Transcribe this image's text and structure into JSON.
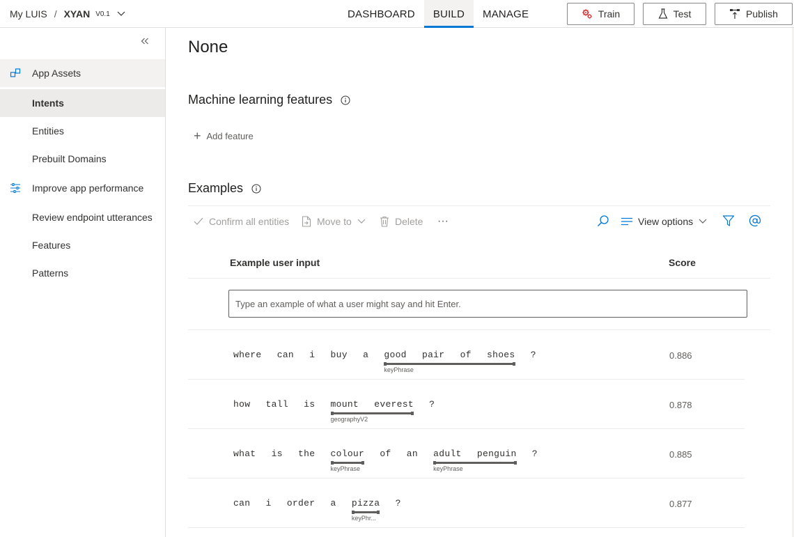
{
  "breadcrumb": {
    "root": "My LUIS",
    "separator": "/",
    "app": "XYAN",
    "version": "V0.1"
  },
  "nav": {
    "tabs": [
      {
        "label": "DASHBOARD"
      },
      {
        "label": "BUILD"
      },
      {
        "label": "MANAGE"
      }
    ],
    "active": "BUILD"
  },
  "actions": {
    "train": "Train",
    "test": "Test",
    "publish": "Publish"
  },
  "sidebar": {
    "app_assets": "App Assets",
    "intents": "Intents",
    "entities": "Entities",
    "prebuilt_domains": "Prebuilt Domains",
    "improve": "Improve app performance",
    "review": "Review endpoint utterances",
    "features": "Features",
    "patterns": "Patterns"
  },
  "main": {
    "intent_title": "None",
    "ml_features_heading": "Machine learning features",
    "add_feature": "Add feature",
    "examples_heading": "Examples",
    "toolbar": {
      "confirm": "Confirm all entities",
      "move_to": "Move to",
      "delete": "Delete",
      "more": "···",
      "view_options": "View options"
    },
    "table": {
      "col_input": "Example user input",
      "col_score": "Score",
      "input_placeholder": "Type an example of what a user might say and hit Enter."
    },
    "utterances": [
      {
        "tokens": [
          {
            "text": "where"
          },
          {
            "text": "can"
          },
          {
            "text": "i"
          },
          {
            "text": "buy"
          },
          {
            "text": "a"
          },
          {
            "text": "good pair of shoes",
            "entity": "keyPhrase"
          },
          {
            "text": "?"
          }
        ],
        "score": "0.886"
      },
      {
        "tokens": [
          {
            "text": "how"
          },
          {
            "text": "tall"
          },
          {
            "text": "is"
          },
          {
            "text": "mount everest",
            "entity": "geographyV2"
          },
          {
            "text": "?"
          }
        ],
        "score": "0.878"
      },
      {
        "tokens": [
          {
            "text": "what"
          },
          {
            "text": "is"
          },
          {
            "text": "the"
          },
          {
            "text": "colour",
            "entity": "keyPhrase"
          },
          {
            "text": "of"
          },
          {
            "text": "an"
          },
          {
            "text": "adult penguin",
            "entity": "keyPhrase"
          },
          {
            "text": "?"
          }
        ],
        "score": "0.885"
      },
      {
        "tokens": [
          {
            "text": "can"
          },
          {
            "text": "i"
          },
          {
            "text": "order"
          },
          {
            "text": "a"
          },
          {
            "text": "pizza",
            "entity": "keyPhr..."
          },
          {
            "text": "?"
          }
        ],
        "score": "0.877"
      }
    ]
  },
  "colors": {
    "accent": "#0078d4",
    "train_icon": "#d13438",
    "text": "#323130",
    "muted": "#a19f9d"
  }
}
